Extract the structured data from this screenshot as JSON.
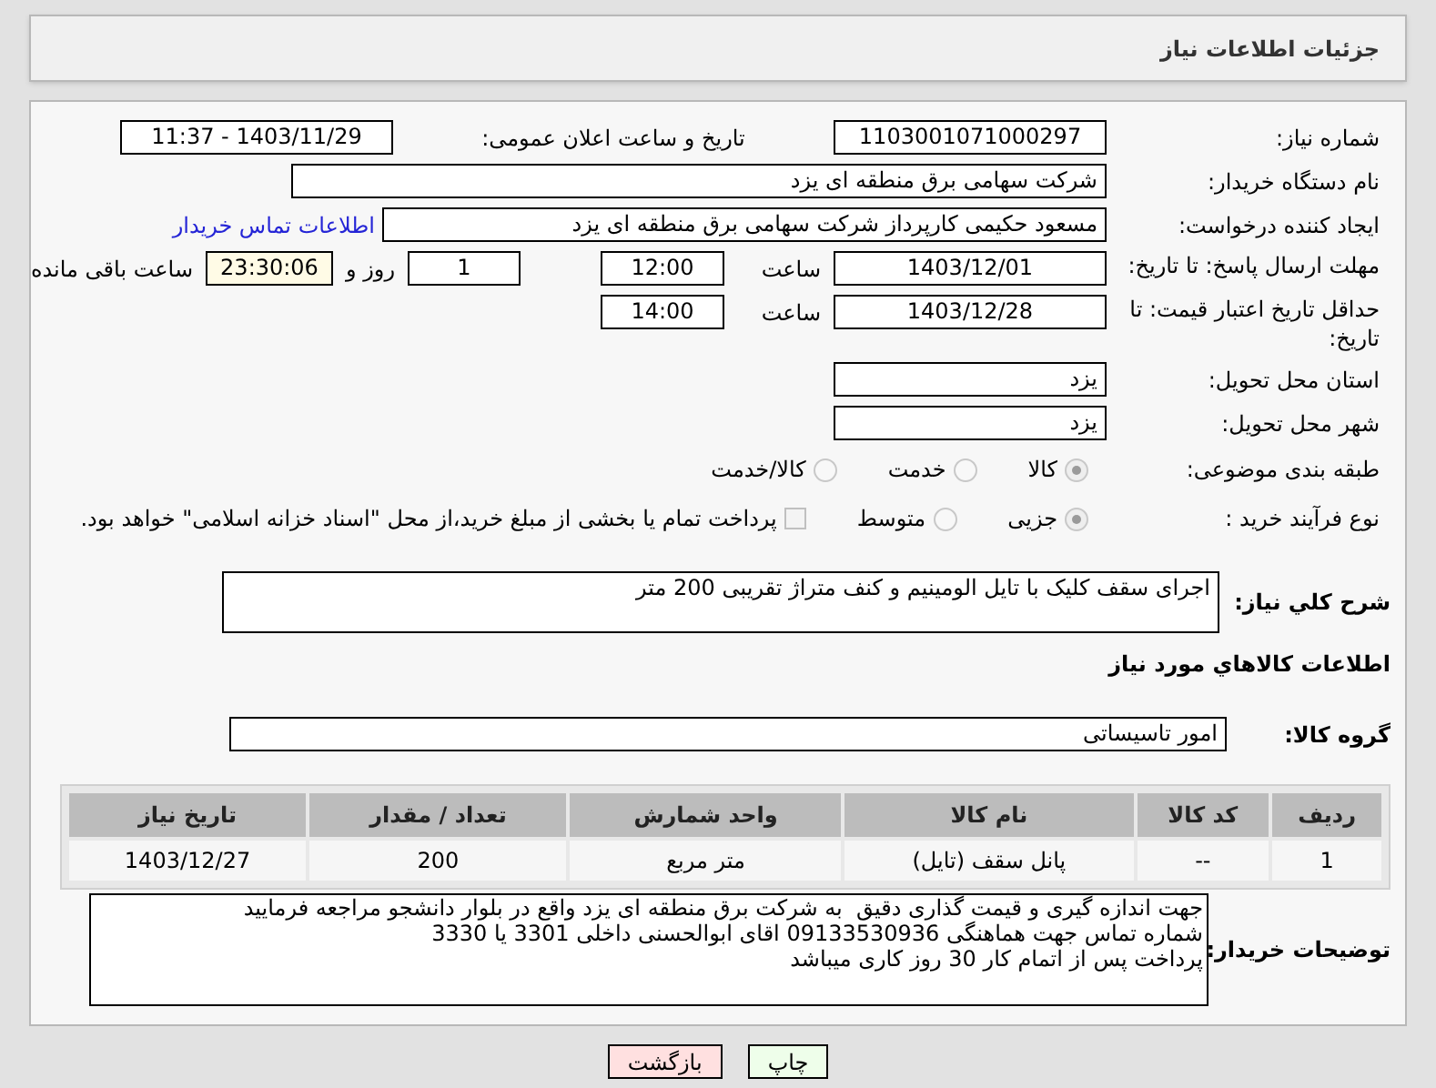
{
  "header": {
    "title": "جزئیات اطلاعات نیاز"
  },
  "need_number": {
    "label": "شماره نیاز:",
    "value": "1103001071000297"
  },
  "announce": {
    "label": "تاریخ و ساعت اعلان عمومی:",
    "value": "1403/11/29 - 11:37"
  },
  "buyer_org": {
    "label": "نام دستگاه خریدار:",
    "value": "شرکت سهامی برق منطقه ای یزد"
  },
  "requester": {
    "label": "ایجاد کننده درخواست:",
    "value": "مسعود حکیمی کارپرداز شرکت سهامی برق منطقه ای یزد",
    "link": "اطلاعات تماس خریدار"
  },
  "response_deadline": {
    "label": "مهلت ارسال پاسخ: تا تاریخ:",
    "date": "1403/12/01",
    "time_label": "ساعت",
    "time": "12:00",
    "days": "1",
    "days_label": "روز و",
    "remaining": "23:30:06",
    "remaining_label": "ساعت باقی مانده"
  },
  "price_validity": {
    "label": "حداقل تاریخ اعتبار قیمت: تا تاریخ:",
    "date": "1403/12/28",
    "time_label": "ساعت",
    "time": "14:00"
  },
  "province": {
    "label": "استان محل تحویل:",
    "value": "یزد"
  },
  "city": {
    "label": "شهر محل تحویل:",
    "value": "یزد"
  },
  "category": {
    "label": "طبقه بندی موضوعی:",
    "options": [
      {
        "label": "کالا",
        "selected": true
      },
      {
        "label": "خدمت",
        "selected": false
      },
      {
        "label": "کالا/خدمت",
        "selected": false
      }
    ]
  },
  "process": {
    "label": "نوع فرآیند خرید :",
    "options": [
      {
        "label": "جزیی",
        "selected": true
      },
      {
        "label": "متوسط",
        "selected": false
      }
    ],
    "payment": {
      "text": "پرداخت تمام یا بخشی از مبلغ خرید،از محل \"اسناد خزانه اسلامی\" خواهد بود.",
      "checked": false
    }
  },
  "description": {
    "label": "شرح کلي نیاز:",
    "value": "اجرای سقف کلیک با تایل الومینیم و کنف متراژ تقریبی 200 متر"
  },
  "goods_title": "اطلاعات کالاهاي مورد نیاز",
  "goods_group": {
    "label": "گروه کالا:",
    "value": "امور تاسیساتی"
  },
  "table": {
    "columns": [
      "ردیف",
      "کد کالا",
      "نام کالا",
      "واحد شمارش",
      "تعداد / مقدار",
      "تاریخ نیاز"
    ],
    "rows": [
      [
        "1",
        "--",
        "پانل سقف (تایل)",
        "متر مربع",
        "200",
        "1403/12/27"
      ]
    ]
  },
  "buyer_notes": {
    "label": "توضیحات خریدار:",
    "lines": [
      "جهت اندازه گیری و قیمت گذاری دقیق  به شرکت برق منطقه ای یزد واقع در بلوار دانشجو مراجعه فرمایید",
      "شماره تماس جهت هماهنگی 09133530936 اقای ابوالحسنی داخلی 3301 یا 3330",
      "پرداخت پس از اتمام کار 30 روز کاری میباشد"
    ]
  },
  "buttons": [
    {
      "label": "چاپ",
      "kind": "print"
    },
    {
      "label": "بازگشت",
      "kind": "back"
    }
  ]
}
